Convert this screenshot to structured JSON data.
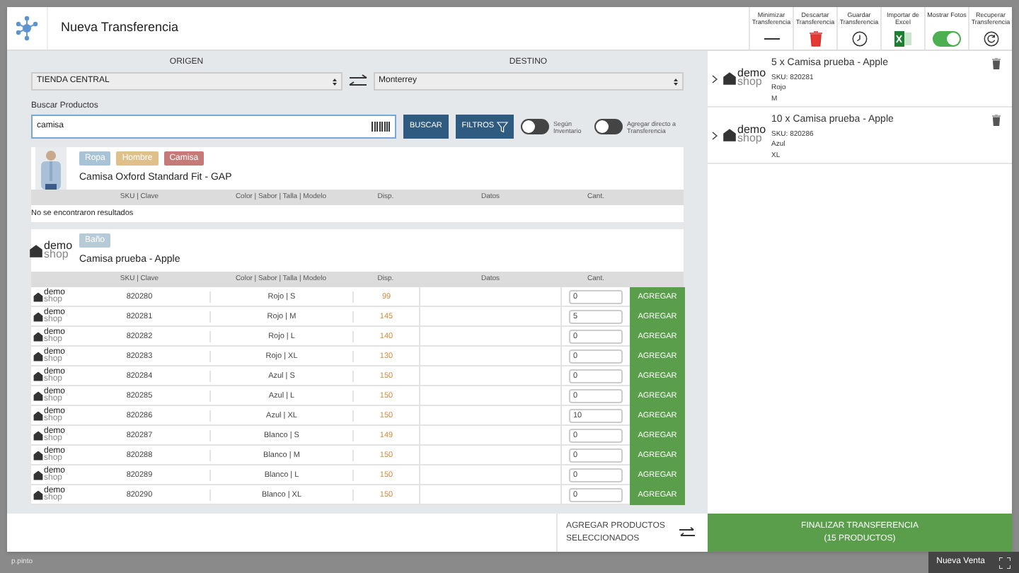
{
  "header": {
    "title": "Nueva Transferencia",
    "actions": [
      {
        "kind": "minimize",
        "label": "Minimizar Transferencia"
      },
      {
        "kind": "discard",
        "label": "Descartar Transferencia"
      },
      {
        "kind": "save",
        "label": "Guardar Transferencia"
      },
      {
        "kind": "excel",
        "label": "Importar de Excel"
      },
      {
        "kind": "toggle",
        "label": "Mostrar Fotos",
        "on": true
      },
      {
        "kind": "recover",
        "label": "Recuperar Transferencia"
      }
    ]
  },
  "origin": {
    "label": "ORIGEN",
    "value": "TIENDA CENTRAL"
  },
  "destination": {
    "label": "DESTINO",
    "value": "Monterrey"
  },
  "search": {
    "label": "Buscar Productos",
    "value": "camisa",
    "button": "BUSCAR",
    "filters_button": "FILTROS",
    "toggles": [
      {
        "label": "Según Inventario",
        "on": false
      },
      {
        "label": "Agregar directo a Transferencia",
        "on": false
      }
    ]
  },
  "products": [
    {
      "name": "Camisa Oxford Standard Fit - GAP",
      "tags": [
        {
          "label": "Ropa",
          "color": "#a9c3d6"
        },
        {
          "label": "Hombre",
          "color": "#dfbf8a"
        },
        {
          "label": "Camisa",
          "color": "#c57a77"
        }
      ],
      "columns": [
        "SKU | Clave",
        "Color | Sabor | Talla | Modelo",
        "Disp.",
        "Datos",
        "Cant."
      ],
      "empty_text": "No se encontraron resultados"
    },
    {
      "kind": "logo",
      "logo": [
        "demo",
        "shop"
      ],
      "name": "Camisa prueba - Apple",
      "tags": [
        {
          "label": "Baño",
          "color": "#b6cad7"
        }
      ],
      "columns": [
        "SKU | Clave",
        "Color | Sabor | Talla | Modelo",
        "Disp.",
        "Datos",
        "Cant."
      ],
      "rows": [
        {
          "logo": [
            "demo",
            "shop"
          ],
          "sku": "820280",
          "variant": "Rojo | S",
          "available": "99",
          "quantity": "0",
          "button": "AGREGAR"
        },
        {
          "logo": [
            "demo",
            "shop"
          ],
          "sku": "820281",
          "variant": "Rojo | M",
          "available": "145",
          "quantity": "5",
          "button": "AGREGAR"
        },
        {
          "logo": [
            "demo",
            "shop"
          ],
          "sku": "820282",
          "variant": "Rojo | L",
          "available": "140",
          "quantity": "0",
          "button": "AGREGAR"
        },
        {
          "logo": [
            "demo",
            "shop"
          ],
          "sku": "820283",
          "variant": "Rojo | XL",
          "available": "130",
          "quantity": "0",
          "button": "AGREGAR"
        },
        {
          "logo": [
            "demo",
            "shop"
          ],
          "sku": "820284",
          "variant": "Azul | S",
          "available": "150",
          "quantity": "0",
          "button": "AGREGAR"
        },
        {
          "logo": [
            "demo",
            "shop"
          ],
          "sku": "820285",
          "variant": "Azul | L",
          "available": "150",
          "quantity": "0",
          "button": "AGREGAR"
        },
        {
          "logo": [
            "demo",
            "shop"
          ],
          "sku": "820286",
          "variant": "Azul | XL",
          "available": "150",
          "quantity": "10",
          "button": "AGREGAR"
        },
        {
          "logo": [
            "demo",
            "shop"
          ],
          "sku": "820287",
          "variant": "Blanco | S",
          "available": "149",
          "quantity": "0",
          "button": "AGREGAR"
        },
        {
          "logo": [
            "demo",
            "shop"
          ],
          "sku": "820288",
          "variant": "Blanco | M",
          "available": "150",
          "quantity": "0",
          "button": "AGREGAR"
        },
        {
          "logo": [
            "demo",
            "shop"
          ],
          "sku": "820289",
          "variant": "Blanco | L",
          "available": "150",
          "quantity": "0",
          "button": "AGREGAR"
        },
        {
          "logo": [
            "demo",
            "shop"
          ],
          "sku": "820290",
          "variant": "Blanco | XL",
          "available": "150",
          "quantity": "0",
          "button": "AGREGAR"
        }
      ]
    }
  ],
  "transfer_items": [
    {
      "logo": [
        "demo",
        "shop"
      ],
      "title": "5 x Camisa prueba - Apple",
      "sku": "SKU: 820281",
      "colour_name": "Rojo",
      "size": "M"
    },
    {
      "logo": [
        "demo",
        "shop"
      ],
      "title": "10 x Camisa prueba - Apple",
      "sku": "SKU: 820286",
      "colour_name": "Azul",
      "size": "XL"
    }
  ],
  "add_selected": "AGREGAR PRODUCTOS SELECCIONADOS",
  "finalize": [
    "FINALIZAR TRANSFERENCIA",
    "(15 PRODUCTOS)"
  ],
  "footer_text": "p.pinto",
  "taskbar": {
    "label": "Nueva Venta"
  }
}
